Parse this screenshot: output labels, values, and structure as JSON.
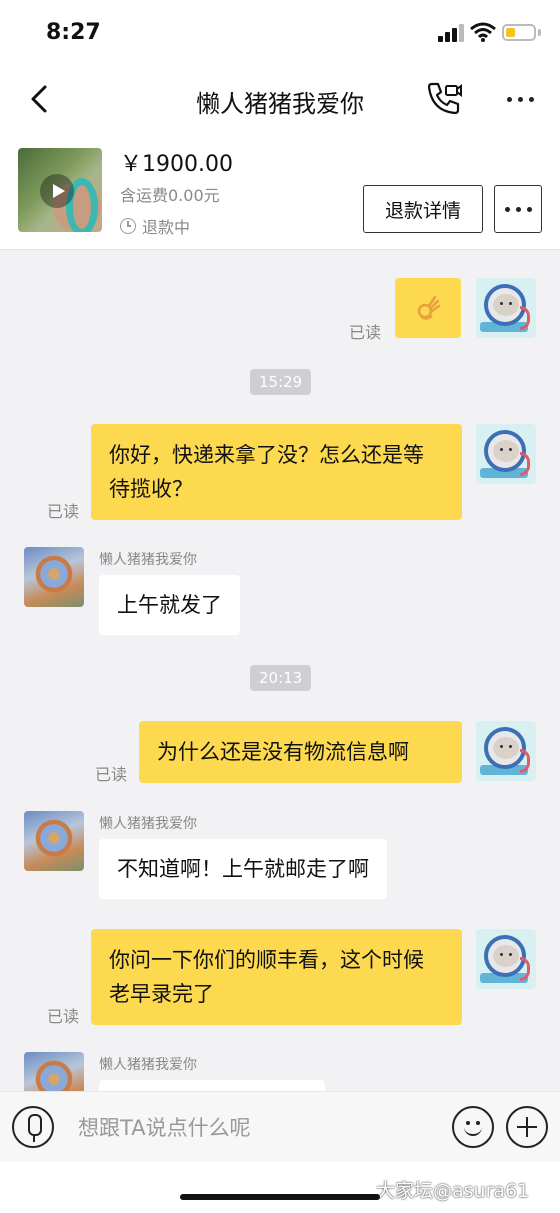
{
  "status_bar": {
    "time": "8:27"
  },
  "nav": {
    "title": "懒人猪猪我爱你"
  },
  "product": {
    "price": "￥1900.00",
    "shipping": "含运费0.00元",
    "status": "退款中",
    "refund_button": "退款详情"
  },
  "messages": {
    "m1_read": "已读",
    "t1": "15:29",
    "m2_text": "你好，快递来拿了没？怎么还是等待揽收？",
    "m2_read": "已读",
    "m3_nick": "懒人猪猪我爱你",
    "m3_text": "上午就发了",
    "t2": "20:13",
    "m4_text": "为什么还是没有物流信息啊",
    "m4_read": "已读",
    "m5_nick": "懒人猪猪我爱你",
    "m5_text": "不知道啊！上午就邮走了啊",
    "m6_text": "你问一下你们的顺丰看，这个时候老早录完了",
    "m6_read": "已读",
    "m7_nick": "懒人猪猪我爱你"
  },
  "input": {
    "placeholder": "想跟TA说点什么呢"
  },
  "watermark": "大家坛@asura61",
  "colors": {
    "my_bubble": "#fdd94f",
    "other_bubble": "#ffffff",
    "background": "#f2f2f4"
  }
}
